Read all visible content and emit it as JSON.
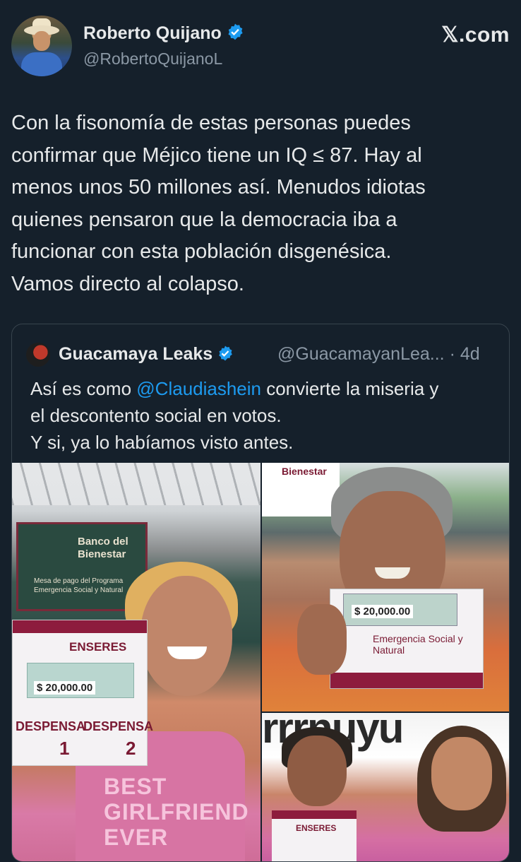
{
  "author": {
    "name": "Roberto Quijano",
    "handle": "@RobertoQuijanoL",
    "site": "𝕏.com"
  },
  "tweet": {
    "lines": [
      "Con la fisonomía de estas personas puedes",
      "confirmar que Méjico tiene un IQ ≤ 87. Hay al",
      "menos unos 50 millones así. Menudos idiotas",
      "quienes pensaron que la democracia iba a",
      "funcionar con esta población disgenésica.",
      "Vamos directo al colapso."
    ]
  },
  "quoted": {
    "name": "Guacamaya Leaks",
    "handle_time": "@GuacamayanLea... · 4d",
    "text_pre": "Así es como ",
    "mention": "@Claudiashein",
    "text_post": " convierte la miseria y",
    "line2": "el descontento social en votos.",
    "line3": "Y si, ya lo habíamos visto antes.",
    "photo1": {
      "banner_title": "Banco del Bienestar",
      "banner_sub": "Mesa de pago del Programa Emergencia Social y Natural",
      "voucher_title": "ENSERES",
      "amount": "$ 20,000.00",
      "label_a": "DESPENSA",
      "num_a": "1",
      "label_b": "DESPENSA",
      "num_b": "2",
      "shirt": "BEST GIRLFRIEND EVER"
    },
    "photo2": {
      "banner_title": "Bienestar",
      "amount": "$ 20,000.00",
      "voucher_text": "Emergencia Social y Natural"
    },
    "photo3": {
      "wall": "rrrnuyu",
      "voucher_title": "ENSERES"
    }
  },
  "colors": {
    "background": "#15202b",
    "text": "#e7e9ea",
    "secondary": "#8b98a5",
    "link": "#1d9bf0",
    "verified": "#1d9bf0",
    "border": "#38444d"
  }
}
